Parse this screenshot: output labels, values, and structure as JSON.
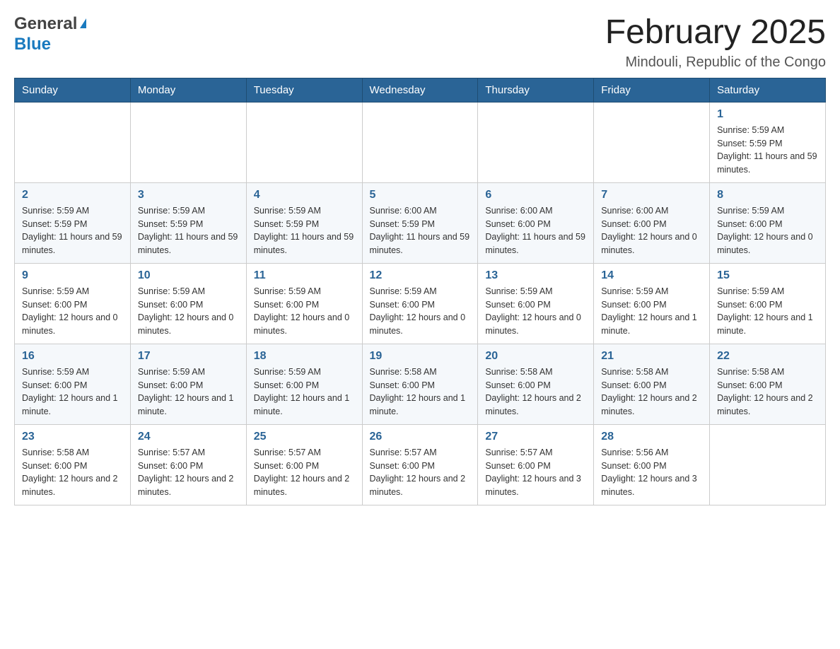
{
  "header": {
    "logo_general": "General",
    "logo_arrow": "▶",
    "logo_blue": "Blue",
    "month_title": "February 2025",
    "location": "Mindouli, Republic of the Congo"
  },
  "calendar": {
    "days_of_week": [
      "Sunday",
      "Monday",
      "Tuesday",
      "Wednesday",
      "Thursday",
      "Friday",
      "Saturday"
    ],
    "weeks": [
      [
        {
          "day": "",
          "info": ""
        },
        {
          "day": "",
          "info": ""
        },
        {
          "day": "",
          "info": ""
        },
        {
          "day": "",
          "info": ""
        },
        {
          "day": "",
          "info": ""
        },
        {
          "day": "",
          "info": ""
        },
        {
          "day": "1",
          "info": "Sunrise: 5:59 AM\nSunset: 5:59 PM\nDaylight: 11 hours and 59 minutes."
        }
      ],
      [
        {
          "day": "2",
          "info": "Sunrise: 5:59 AM\nSunset: 5:59 PM\nDaylight: 11 hours and 59 minutes."
        },
        {
          "day": "3",
          "info": "Sunrise: 5:59 AM\nSunset: 5:59 PM\nDaylight: 11 hours and 59 minutes."
        },
        {
          "day": "4",
          "info": "Sunrise: 5:59 AM\nSunset: 5:59 PM\nDaylight: 11 hours and 59 minutes."
        },
        {
          "day": "5",
          "info": "Sunrise: 6:00 AM\nSunset: 5:59 PM\nDaylight: 11 hours and 59 minutes."
        },
        {
          "day": "6",
          "info": "Sunrise: 6:00 AM\nSunset: 6:00 PM\nDaylight: 11 hours and 59 minutes."
        },
        {
          "day": "7",
          "info": "Sunrise: 6:00 AM\nSunset: 6:00 PM\nDaylight: 12 hours and 0 minutes."
        },
        {
          "day": "8",
          "info": "Sunrise: 5:59 AM\nSunset: 6:00 PM\nDaylight: 12 hours and 0 minutes."
        }
      ],
      [
        {
          "day": "9",
          "info": "Sunrise: 5:59 AM\nSunset: 6:00 PM\nDaylight: 12 hours and 0 minutes."
        },
        {
          "day": "10",
          "info": "Sunrise: 5:59 AM\nSunset: 6:00 PM\nDaylight: 12 hours and 0 minutes."
        },
        {
          "day": "11",
          "info": "Sunrise: 5:59 AM\nSunset: 6:00 PM\nDaylight: 12 hours and 0 minutes."
        },
        {
          "day": "12",
          "info": "Sunrise: 5:59 AM\nSunset: 6:00 PM\nDaylight: 12 hours and 0 minutes."
        },
        {
          "day": "13",
          "info": "Sunrise: 5:59 AM\nSunset: 6:00 PM\nDaylight: 12 hours and 0 minutes."
        },
        {
          "day": "14",
          "info": "Sunrise: 5:59 AM\nSunset: 6:00 PM\nDaylight: 12 hours and 1 minute."
        },
        {
          "day": "15",
          "info": "Sunrise: 5:59 AM\nSunset: 6:00 PM\nDaylight: 12 hours and 1 minute."
        }
      ],
      [
        {
          "day": "16",
          "info": "Sunrise: 5:59 AM\nSunset: 6:00 PM\nDaylight: 12 hours and 1 minute."
        },
        {
          "day": "17",
          "info": "Sunrise: 5:59 AM\nSunset: 6:00 PM\nDaylight: 12 hours and 1 minute."
        },
        {
          "day": "18",
          "info": "Sunrise: 5:59 AM\nSunset: 6:00 PM\nDaylight: 12 hours and 1 minute."
        },
        {
          "day": "19",
          "info": "Sunrise: 5:58 AM\nSunset: 6:00 PM\nDaylight: 12 hours and 1 minute."
        },
        {
          "day": "20",
          "info": "Sunrise: 5:58 AM\nSunset: 6:00 PM\nDaylight: 12 hours and 2 minutes."
        },
        {
          "day": "21",
          "info": "Sunrise: 5:58 AM\nSunset: 6:00 PM\nDaylight: 12 hours and 2 minutes."
        },
        {
          "day": "22",
          "info": "Sunrise: 5:58 AM\nSunset: 6:00 PM\nDaylight: 12 hours and 2 minutes."
        }
      ],
      [
        {
          "day": "23",
          "info": "Sunrise: 5:58 AM\nSunset: 6:00 PM\nDaylight: 12 hours and 2 minutes."
        },
        {
          "day": "24",
          "info": "Sunrise: 5:57 AM\nSunset: 6:00 PM\nDaylight: 12 hours and 2 minutes."
        },
        {
          "day": "25",
          "info": "Sunrise: 5:57 AM\nSunset: 6:00 PM\nDaylight: 12 hours and 2 minutes."
        },
        {
          "day": "26",
          "info": "Sunrise: 5:57 AM\nSunset: 6:00 PM\nDaylight: 12 hours and 2 minutes."
        },
        {
          "day": "27",
          "info": "Sunrise: 5:57 AM\nSunset: 6:00 PM\nDaylight: 12 hours and 3 minutes."
        },
        {
          "day": "28",
          "info": "Sunrise: 5:56 AM\nSunset: 6:00 PM\nDaylight: 12 hours and 3 minutes."
        },
        {
          "day": "",
          "info": ""
        }
      ]
    ]
  }
}
